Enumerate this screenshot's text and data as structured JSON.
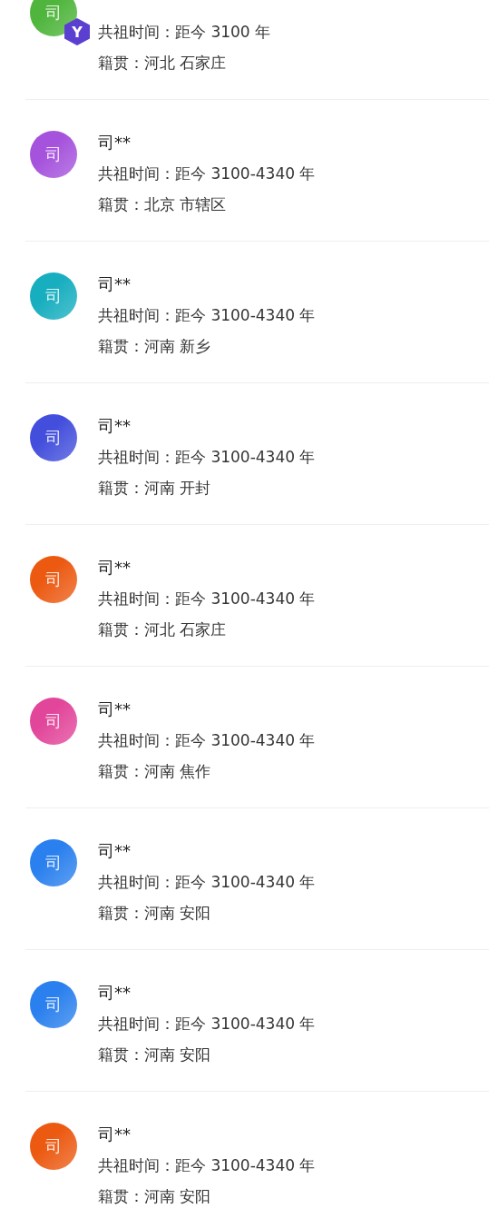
{
  "members": [
    {
      "avatar": "司",
      "color": "#4fb53c",
      "badge": "Y",
      "ancestor_time": "共祖时间：距今 3100 年",
      "origin": "籍贯：河北 石家庄"
    },
    {
      "avatar": "司",
      "color": "#a552dc",
      "name": "司**",
      "ancestor_time": "共祖时间：距今 3100-4340 年",
      "origin": "籍贯：北京 市辖区"
    },
    {
      "avatar": "司",
      "color": "#17aebf",
      "name": "司**",
      "ancestor_time": "共祖时间：距今 3100-4340 年",
      "origin": "籍贯：河南 新乡"
    },
    {
      "avatar": "司",
      "color": "#434fdc",
      "name": "司**",
      "ancestor_time": "共祖时间：距今 3100-4340 年",
      "origin": "籍贯：河南 开封"
    },
    {
      "avatar": "司",
      "color": "#ec5a12",
      "name": "司**",
      "ancestor_time": "共祖时间：距今 3100-4340 年",
      "origin": "籍贯：河北 石家庄"
    },
    {
      "avatar": "司",
      "color": "#e2469a",
      "name": "司**",
      "ancestor_time": "共祖时间：距今 3100-4340 年",
      "origin": "籍贯：河南 焦作"
    },
    {
      "avatar": "司",
      "color": "#2a80ee",
      "name": "司**",
      "ancestor_time": "共祖时间：距今 3100-4340 年",
      "origin": "籍贯：河南 安阳"
    },
    {
      "avatar": "司",
      "color": "#2a80ee",
      "name": "司**",
      "ancestor_time": "共祖时间：距今 3100-4340 年",
      "origin": "籍贯：河南 安阳"
    },
    {
      "avatar": "司",
      "color": "#ec5a12",
      "name": "司**",
      "ancestor_time": "共祖时间：距今 3100-4340 年",
      "origin": "籍贯：河南 安阳"
    }
  ]
}
